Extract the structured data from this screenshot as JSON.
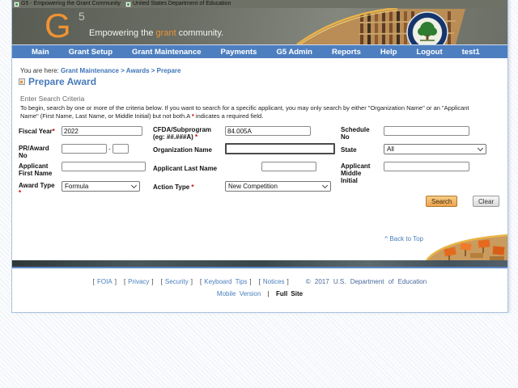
{
  "browser_strip": {
    "site_links": [
      {
        "label": "G5 - Empowering the Grant Community"
      },
      {
        "label": "United States Department of Education"
      }
    ]
  },
  "banner": {
    "logo_g": "G",
    "logo_5": "5",
    "tagline_prefix": "Empowering the ",
    "tagline_highlight": "grant",
    "tagline_suffix": " community."
  },
  "nav": {
    "items": [
      "Main",
      "Grant Setup",
      "Grant Maintenance",
      "Payments",
      "G5 Admin",
      "Reports",
      "Help",
      "Logout",
      "test1"
    ]
  },
  "breadcrumb": {
    "prefix": "You are here: ",
    "path": "Grant Maintenance > Awards > Prepare"
  },
  "page": {
    "title": "Prepare Award"
  },
  "search_criteria": {
    "section_title": "Enter Search Criteria",
    "instructions_line1": "To begin, search by one or more of the criteria below. If you want to search for a specific applicant, you may only search by either \"Organization Name\" or an \"Applicant",
    "instructions_line2_before": "Name\" (First Name, Last Name, or Middle Initial) but not both.A ",
    "required_marker": "*",
    "instructions_line2_after": " indicates a required field.",
    "fields": {
      "fiscal_year": {
        "label": "Fiscal Year",
        "required": "*",
        "value": "2022"
      },
      "cfda": {
        "label_line1": "CFDA/Subprogram",
        "label_line2": "(eg: ##.###A) ",
        "required": "*",
        "value": "84.005A"
      },
      "schedule_no": {
        "label": "Schedule No",
        "value": ""
      },
      "pr_award_no": {
        "label": "PR/Award No",
        "value_part1": "",
        "separator": "-",
        "value_part2": ""
      },
      "organization_name": {
        "label": "Organization Name",
        "value": ""
      },
      "state": {
        "label": "State",
        "value": "All"
      },
      "applicant_first_name": {
        "label": "Applicant First Name",
        "value": ""
      },
      "applicant_last_name": {
        "label": "Applicant Last Name",
        "value": ""
      },
      "applicant_middle_initial": {
        "label": "Applicant Middle Initial",
        "value": ""
      },
      "award_type": {
        "label": "Award Type",
        "required": "*",
        "value": "Formula"
      },
      "action_type": {
        "label": "Action Type ",
        "required": "*",
        "value": "New Competition"
      }
    },
    "buttons": {
      "search": "Search",
      "clear": "Clear"
    }
  },
  "back_to_top": "^ Back to Top",
  "footer": {
    "bracket_open": "[",
    "bracket_close": "]",
    "links": [
      "FOIA",
      "Privacy",
      "Security",
      "Keyboard Tips",
      "Notices"
    ],
    "copyright": "© 2017 U.S. Department of Education",
    "mobile_version": "Mobile Version",
    "divider": "|",
    "full_site": "Full Site"
  },
  "colors": {
    "nav_blue": "#4d7fc0",
    "link_blue": "#3f74b8",
    "brand_orange": "#ef9332",
    "required_red": "#cc0000",
    "search_button_orange": "#f3b257",
    "seal_navy": "#16356b",
    "seal_green": "#2e7d32"
  }
}
